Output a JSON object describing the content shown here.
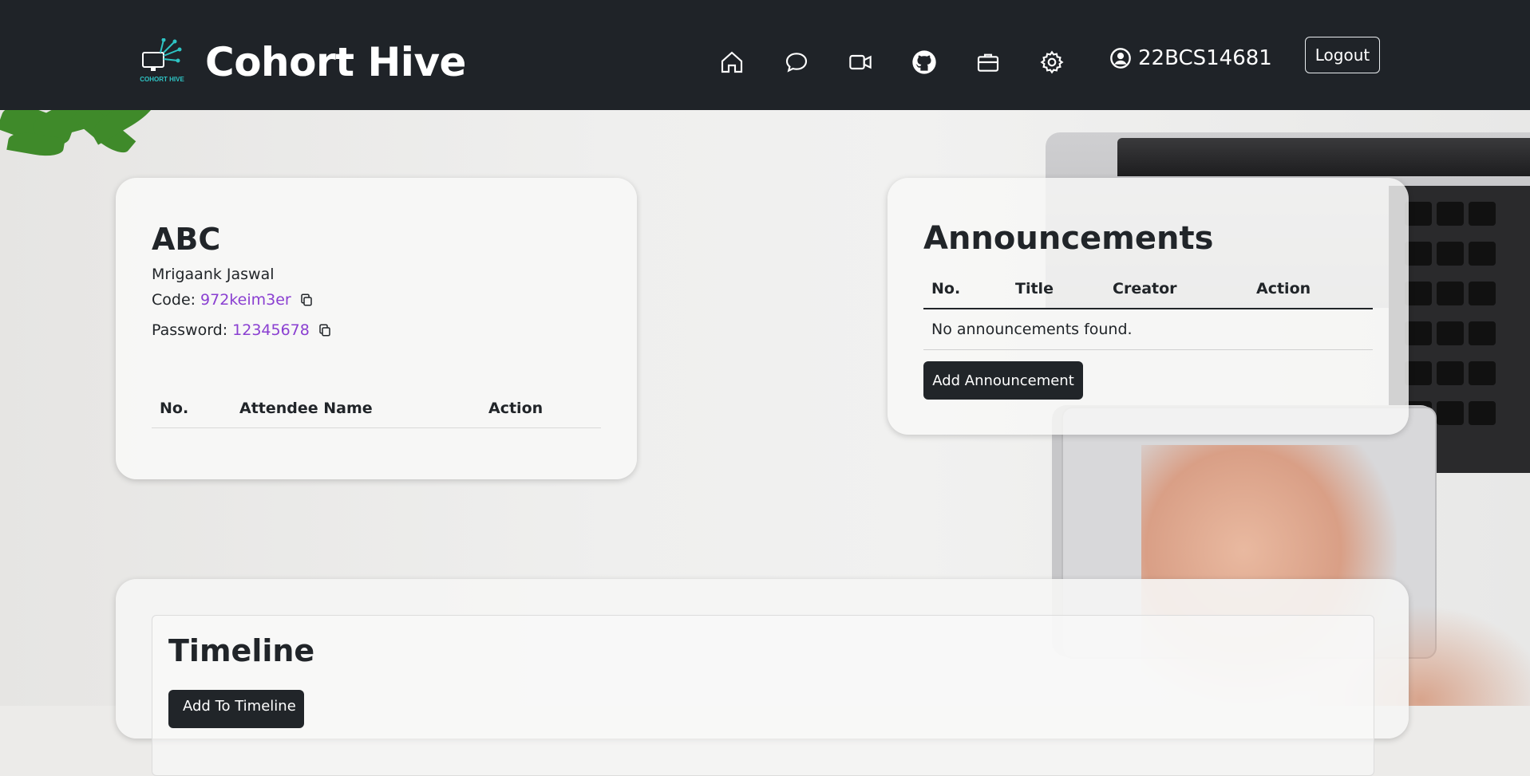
{
  "brand": {
    "title": "Cohort Hive",
    "logo_text": "COHORT HIVE"
  },
  "nav": {
    "icons": [
      "home-icon",
      "chat-icon",
      "video-icon",
      "github-icon",
      "briefcase-icon",
      "gear-icon"
    ],
    "user_id": "22BCS14681",
    "logout_label": "Logout"
  },
  "class_card": {
    "title": "ABC",
    "creator": "Mrigaank Jaswal",
    "code_label": "Code:",
    "code_value": "972keim3er",
    "password_label": "Password:",
    "password_value": "12345678",
    "attendee_headers": [
      "No.",
      "Attendee Name",
      "Action"
    ]
  },
  "announcements": {
    "title": "Announcements",
    "headers": [
      "No.",
      "Title",
      "Creator",
      "Action"
    ],
    "empty_text": "No announcements found.",
    "add_button": "Add Announcement"
  },
  "timeline": {
    "title": "Timeline",
    "add_button": "Add To Timeline"
  },
  "colors": {
    "navbar": "#1f2328",
    "accent_link": "#8a3fd1",
    "button_dark": "#212529",
    "logo_cyan": "#2ec4c4"
  }
}
